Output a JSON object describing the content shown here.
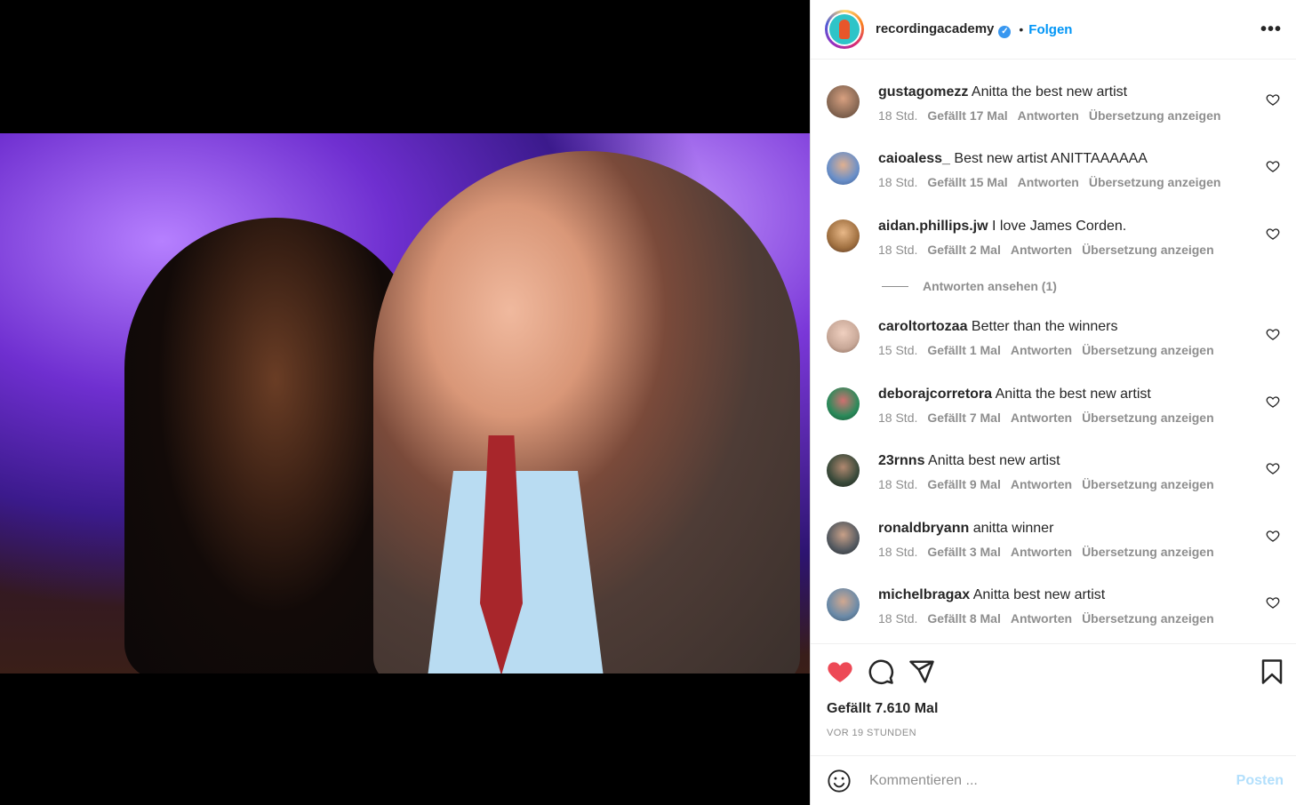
{
  "header": {
    "username": "recordingacademy",
    "verified_mark": "✓",
    "separator": "•",
    "follow_label": "Folgen",
    "more_label": "•••"
  },
  "comments": [
    {
      "username": "gustagomezz",
      "text": "Anitta the best new artist",
      "time": "18 Std.",
      "likes": "Gefällt 17 Mal",
      "reply": "Antworten",
      "translate": "Übersetzung anzeigen",
      "avatar_color": "#8a6a55"
    },
    {
      "username": "caioaless_",
      "text": "Best new artist ANITTAAAAAA",
      "time": "18 Std.",
      "likes": "Gefällt 15 Mal",
      "reply": "Antworten",
      "translate": "Übersetzung anzeigen",
      "avatar_color": "#6a8fc8"
    },
    {
      "username": "aidan.phillips.jw",
      "text": "I love James Corden.",
      "time": "18 Std.",
      "likes": "Gefällt 2 Mal",
      "reply": "Antworten",
      "translate": "Übersetzung anzeigen",
      "avatar_color": "#a07040"
    },
    {
      "username": "caroltortozaa",
      "text": "Better than the winners",
      "time": "15 Std.",
      "likes": "Gefällt 1 Mal",
      "reply": "Antworten",
      "translate": "Übersetzung anzeigen",
      "avatar_color": "#c8a898"
    },
    {
      "username": "deborajcorretora",
      "text": "Anitta the best new artist",
      "time": "18 Std.",
      "likes": "Gefällt 7 Mal",
      "reply": "Antworten",
      "translate": "Übersetzung anzeigen",
      "avatar_color": "#2a8a5a"
    },
    {
      "username": "23rnns",
      "text": "Anitta best new artist",
      "time": "18 Std.",
      "likes": "Gefällt 9 Mal",
      "reply": "Antworten",
      "translate": "Übersetzung anzeigen",
      "avatar_color": "#3a4a3a"
    },
    {
      "username": "ronaldbryann",
      "text": "anitta winner",
      "time": "18 Std.",
      "likes": "Gefällt 3 Mal",
      "reply": "Antworten",
      "translate": "Übersetzung anzeigen",
      "avatar_color": "#555a60"
    },
    {
      "username": "michelbragax",
      "text": "Anitta best new artist",
      "time": "18 Std.",
      "likes": "Gefällt 8 Mal",
      "reply": "Antworten",
      "translate": "Übersetzung anzeigen",
      "avatar_color": "#6a8aa8"
    }
  ],
  "view_replies": "Antworten ansehen (1)",
  "actions": {
    "like_icon": "heart-filled-icon",
    "comment_icon": "comment-icon",
    "share_icon": "send-icon",
    "save_icon": "bookmark-icon",
    "like_color": "#ed4956"
  },
  "likes_count": "Gefällt 7.610 Mal",
  "posted_time": "VOR 19 STUNDEN",
  "comment_input": {
    "placeholder": "Kommentieren ...",
    "post_label": "Posten"
  }
}
